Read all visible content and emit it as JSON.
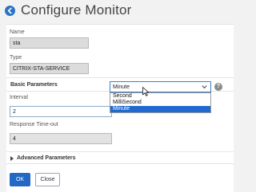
{
  "header": {
    "title": "Configure Monitor",
    "back_icon": "back-arrow-icon"
  },
  "form": {
    "name": {
      "label": "Name",
      "value": "sta"
    },
    "type": {
      "label": "Type",
      "value": "CITRIX-STA-SERVICE"
    },
    "basic_section": "Basic Parameters",
    "interval": {
      "label": "Interval",
      "value": "2",
      "unit_selected": "Minute",
      "unit_options": [
        "Second",
        "MilliSecond",
        "Minute"
      ],
      "help_symbol": "?"
    },
    "response_timeout": {
      "label": "Response Time-out",
      "value": "4"
    },
    "advanced_section": "Advanced Parameters"
  },
  "buttons": {
    "ok": "OK",
    "close": "Close"
  },
  "colors": {
    "accent": "#2268c4",
    "selected_option": "#1e6ad0"
  }
}
